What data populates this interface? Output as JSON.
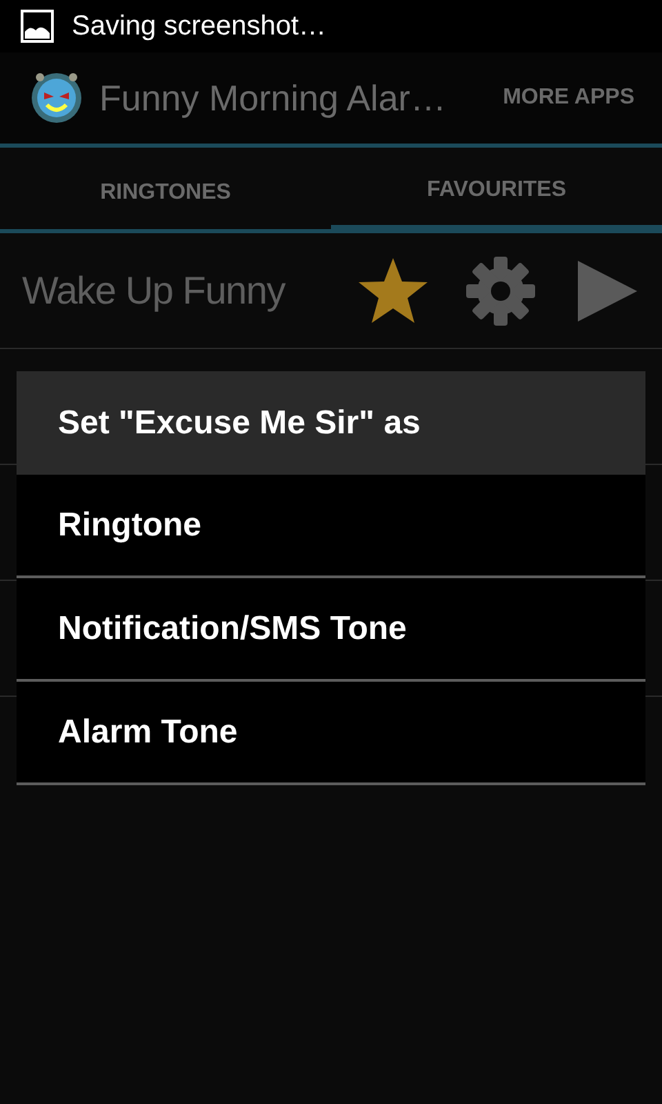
{
  "status_bar": {
    "notification": "Saving screenshot…"
  },
  "action_bar": {
    "title": "Funny Morning Alar…",
    "action": "MORE APPS"
  },
  "tabs": [
    {
      "label": "RINGTONES",
      "selected": false
    },
    {
      "label": "FAVOURITES",
      "selected": true
    }
  ],
  "header_row": {
    "title": "Wake Up Funny",
    "favourite": true
  },
  "dialog": {
    "title": "Set \"Excuse Me Sir\" as",
    "options": [
      "Ringtone",
      "Notification/SMS Tone",
      "Alarm Tone"
    ]
  }
}
